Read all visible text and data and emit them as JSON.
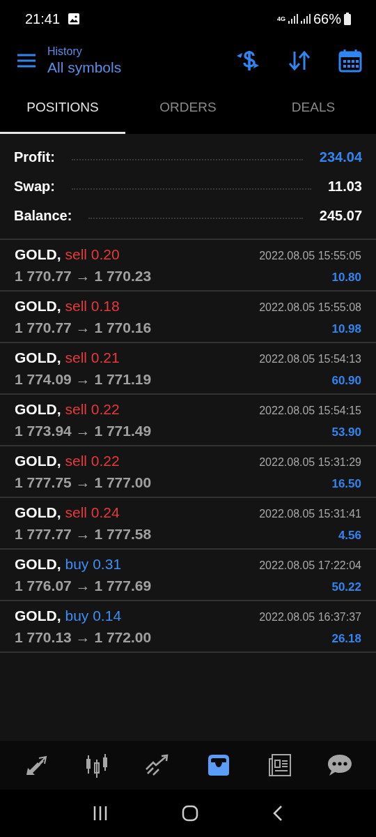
{
  "status_bar": {
    "time": "21:41",
    "network": "4G",
    "battery": "66%"
  },
  "header": {
    "subtitle": "History",
    "title": "All symbols"
  },
  "tabs": [
    {
      "label": "POSITIONS",
      "selected": true
    },
    {
      "label": "ORDERS",
      "selected": false
    },
    {
      "label": "DEALS",
      "selected": false
    }
  ],
  "summary": [
    {
      "label": "Profit:",
      "value": "234.04",
      "color": "#2f86f0"
    },
    {
      "label": "Swap:",
      "value": "11.03",
      "color": "#ffffff"
    },
    {
      "label": "Balance:",
      "value": "245.07",
      "color": "#ffffff"
    }
  ],
  "positions": [
    {
      "symbol": "GOLD,",
      "kind": "sell",
      "volume": "sell 0.20",
      "prices": "1 770.77 → 1 770.23",
      "time": "2022.08.05 15:55:05",
      "profit": "10.80"
    },
    {
      "symbol": "GOLD,",
      "kind": "sell",
      "volume": "sell 0.18",
      "prices": "1 770.77 → 1 770.16",
      "time": "2022.08.05 15:55:08",
      "profit": "10.98"
    },
    {
      "symbol": "GOLD,",
      "kind": "sell",
      "volume": "sell 0.21",
      "prices": "1 774.09 → 1 771.19",
      "time": "2022.08.05 15:54:13",
      "profit": "60.90"
    },
    {
      "symbol": "GOLD,",
      "kind": "sell",
      "volume": "sell 0.22",
      "prices": "1 773.94 → 1 771.49",
      "time": "2022.08.05 15:54:15",
      "profit": "53.90"
    },
    {
      "symbol": "GOLD,",
      "kind": "sell",
      "volume": "sell 0.22",
      "prices": "1 777.75 → 1 777.00",
      "time": "2022.08.05 15:31:29",
      "profit": "16.50"
    },
    {
      "symbol": "GOLD,",
      "kind": "sell",
      "volume": "sell 0.24",
      "prices": "1 777.77 → 1 777.58",
      "time": "2022.08.05 15:31:41",
      "profit": "4.56"
    },
    {
      "symbol": "GOLD,",
      "kind": "buy",
      "volume": "buy 0.31",
      "prices": "1 776.07 → 1 777.69",
      "time": "2022.08.05 17:22:04",
      "profit": "50.22"
    },
    {
      "symbol": "GOLD,",
      "kind": "buy",
      "volume": "buy 0.14",
      "prices": "1 770.13 → 1 772.00",
      "time": "2022.08.05 16:37:37",
      "profit": "26.18"
    }
  ],
  "bottom_nav": [
    {
      "kind": "trade",
      "selected": false
    },
    {
      "kind": "chart",
      "selected": false
    },
    {
      "kind": "quotes",
      "selected": false
    },
    {
      "kind": "history",
      "selected": true
    },
    {
      "kind": "news",
      "selected": false
    },
    {
      "kind": "chat",
      "selected": false
    }
  ]
}
